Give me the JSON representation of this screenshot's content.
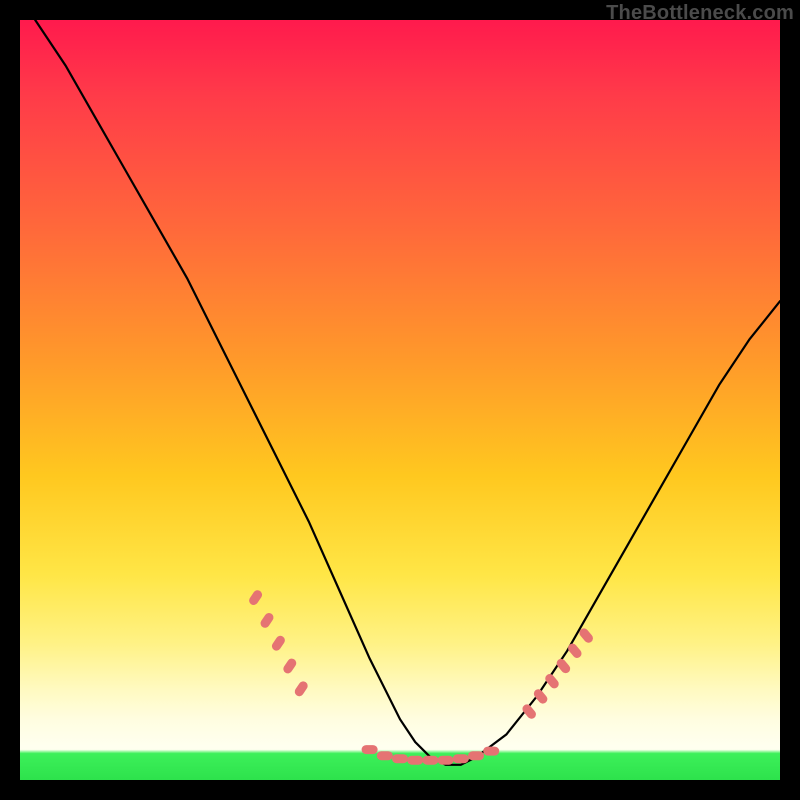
{
  "watermark": "TheBottleneck.com",
  "chart_data": {
    "type": "line",
    "title": "",
    "xlabel": "",
    "ylabel": "",
    "xlim": [
      0,
      100
    ],
    "ylim": [
      0,
      100
    ],
    "grid": false,
    "legend": false,
    "series": [
      {
        "name": "curve",
        "color": "#000000",
        "x": [
          2,
          6,
          10,
          14,
          18,
          22,
          26,
          30,
          34,
          38,
          42,
          46,
          50,
          52,
          54,
          56,
          58,
          60,
          64,
          68,
          72,
          76,
          80,
          84,
          88,
          92,
          96,
          100
        ],
        "y": [
          100,
          94,
          87,
          80,
          73,
          66,
          58,
          50,
          42,
          34,
          25,
          16,
          8,
          5,
          3,
          2,
          2,
          3,
          6,
          11,
          17,
          24,
          31,
          38,
          45,
          52,
          58,
          63
        ]
      },
      {
        "name": "markers-left",
        "color": "#e57373",
        "type": "scatter",
        "x": [
          31,
          32.5,
          34,
          35.5,
          37
        ],
        "y": [
          24,
          21,
          18,
          15,
          12
        ]
      },
      {
        "name": "markers-bottom",
        "color": "#e57373",
        "type": "scatter",
        "x": [
          46,
          48,
          50,
          52,
          54,
          56,
          58,
          60,
          62
        ],
        "y": [
          4.0,
          3.2,
          2.8,
          2.6,
          2.6,
          2.6,
          2.8,
          3.2,
          3.8
        ]
      },
      {
        "name": "markers-right",
        "color": "#e57373",
        "type": "scatter",
        "x": [
          67,
          68.5,
          70,
          71.5,
          73,
          74.5
        ],
        "y": [
          9,
          11,
          13,
          15,
          17,
          19
        ]
      }
    ],
    "annotations": []
  }
}
